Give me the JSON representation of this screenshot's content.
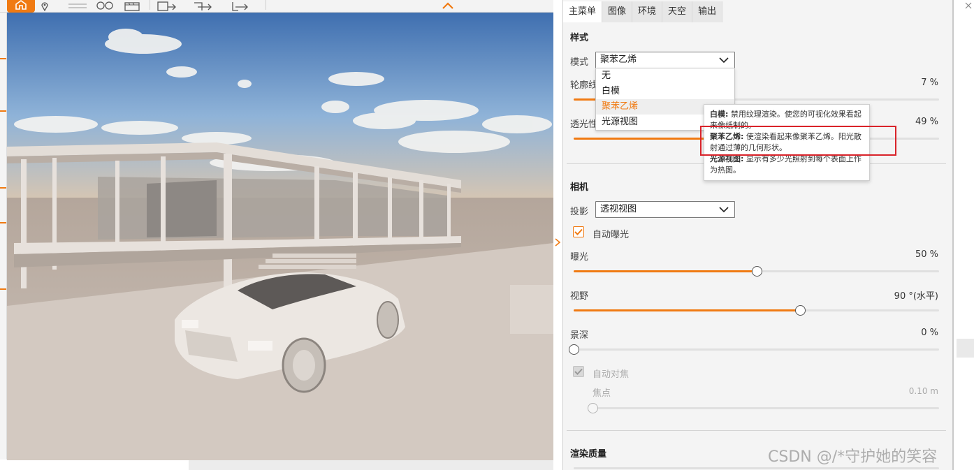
{
  "panel": {
    "tabs": [
      "主菜单",
      "图像",
      "环境",
      "天空",
      "输出"
    ],
    "style_section": {
      "title": "样式",
      "mode_label": "模式",
      "mode_value": "聚苯乙烯",
      "mode_options": [
        "无",
        "白模",
        "聚苯乙烯",
        "光源视图"
      ],
      "highlighted_option": "聚苯乙烯",
      "outline_label": "轮廓线",
      "outline_value": "7 %",
      "outline_level": 0.07,
      "translucency_label": "透光性",
      "translucency_value": "49 %",
      "translucency_level": 0.49
    },
    "tooltip": {
      "item1_name": "白模:",
      "item1_text": "禁用纹理渲染。使您的可视化效果看起来像纸制的。",
      "item2_name": "聚苯乙烯:",
      "item2_text": "使渲染看起来像聚苯乙烯。阳光散射通过薄的几何形状。",
      "item3_name": "光源视图:",
      "item3_text": "显示有多少光照射到每个表面上作为热图。"
    },
    "camera_section": {
      "title": "相机",
      "projection_label": "投影",
      "projection_value": "透视视图",
      "auto_exposure_label": "自动曝光",
      "auto_exposure_checked": true,
      "exposure_label": "曝光",
      "exposure_value": "50 %",
      "exposure_level": 0.5,
      "fov_label": "视野",
      "fov_value": "90 °(水平)",
      "fov_level": 0.62,
      "dof_label": "景深",
      "dof_value": "0 %",
      "dof_level": 0.0,
      "autofocus_label": "自动对焦",
      "autofocus_checked": true,
      "focus_label": "焦点",
      "focus_value": "0.10 m",
      "focus_level": 0.0
    },
    "render_section": {
      "title": "渲染质量"
    }
  },
  "watermark": "CSDN @/*守护她的笑容",
  "colors": {
    "accent": "#f07a12",
    "highlight_box": "#d9232a",
    "panel_bg": "#f4f4f4"
  },
  "icons": [
    "home-icon",
    "location-pin-icon",
    "lines-icon",
    "binoculars-icon",
    "clapperboard-icon",
    "export-image-icon",
    "export-arrow-icon",
    "export-arrow-2-icon",
    "chevron-up-icon",
    "chevron-right-icon",
    "chevron-down-icon",
    "close-icon",
    "checkmark-icon"
  ]
}
